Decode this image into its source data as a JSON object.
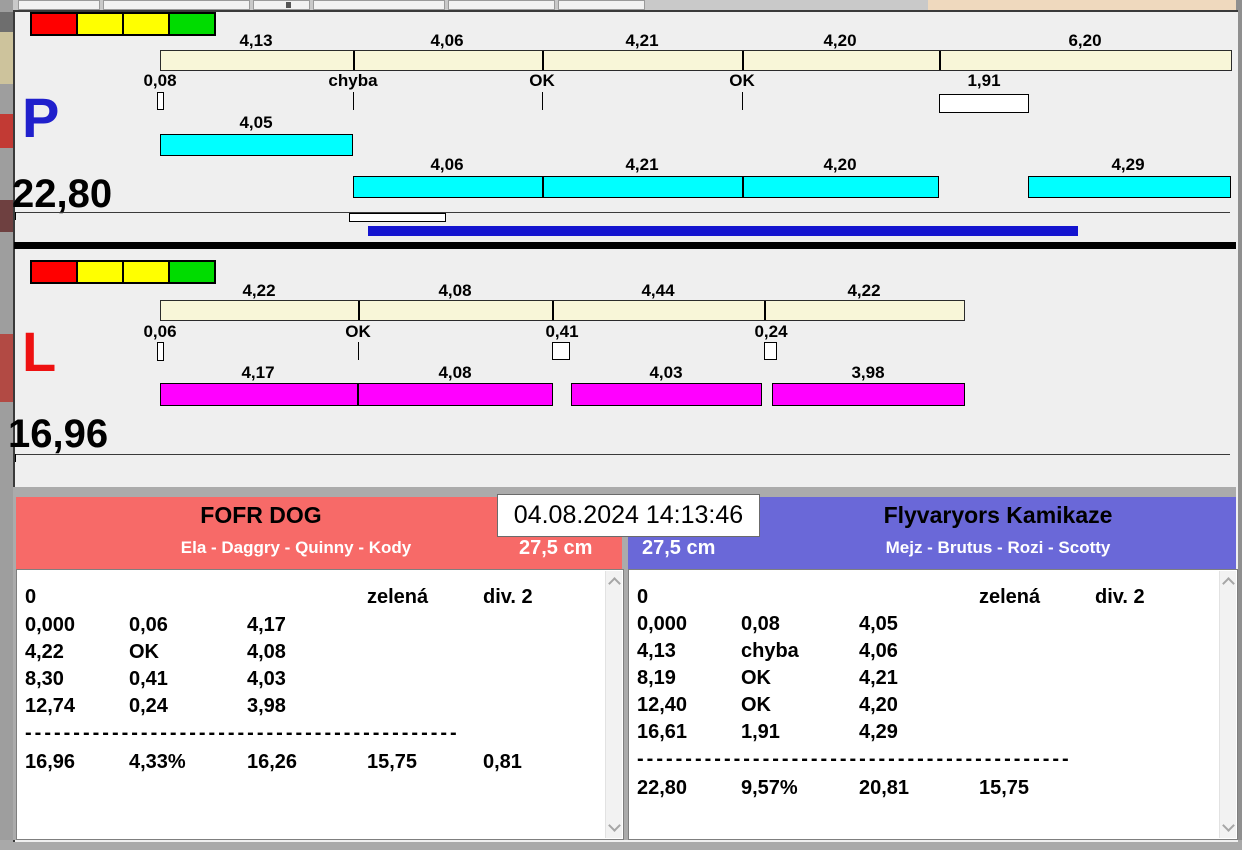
{
  "lanes": {
    "p": {
      "letter": "P",
      "total": "22,80",
      "splits": [
        "4,13",
        "4,06",
        "4,21",
        "4,20",
        "6,20"
      ],
      "crossings": [
        "0,08",
        "chyba",
        "OK",
        "OK",
        "1,91"
      ],
      "dog_times": [
        "4,05",
        "4,06",
        "4,21",
        "4,20",
        "4,29"
      ]
    },
    "l": {
      "letter": "L",
      "total": "16,96",
      "splits": [
        "4,22",
        "4,08",
        "4,44",
        "4,22"
      ],
      "crossings": [
        "0,06",
        "OK",
        "0,41",
        "0,24"
      ],
      "dog_times": [
        "4,17",
        "4,08",
        "4,03",
        "3,98"
      ]
    }
  },
  "scoreboard": {
    "datetime": "04.08.2024 14:13:46",
    "left": {
      "team_name": "FOFR DOG",
      "dog_names": "Ela - Daggry - Quinny - Kody",
      "jump_height": "27,5 cm",
      "table": {
        "header_row": [
          "0",
          "zelená",
          "div. 2"
        ],
        "rows": [
          [
            "0,000",
            "0,06",
            "4,17"
          ],
          [
            "4,22",
            "OK",
            "4,08"
          ],
          [
            "8,30",
            "0,41",
            "4,03"
          ],
          [
            "12,74",
            "0,24",
            "3,98"
          ]
        ],
        "dashes": "---------------------------------------------",
        "total_row": [
          "16,96",
          "4,33%",
          "16,26",
          "15,75",
          "0,81"
        ]
      }
    },
    "right": {
      "team_name": "Flyvaryors Kamikaze",
      "dog_names": "Mejz - Brutus - Rozi - Scotty",
      "jump_height": "27,5 cm",
      "table": {
        "header_row": [
          "0",
          "zelená",
          "div. 2"
        ],
        "rows": [
          [
            "0,000",
            "0,08",
            "4,05"
          ],
          [
            "4,13",
            "chyba",
            "4,06"
          ],
          [
            "8,19",
            "OK",
            "4,21"
          ],
          [
            "12,40",
            "OK",
            "4,20"
          ],
          [
            "16,61",
            "1,91",
            "4,29"
          ]
        ],
        "dashes": "---------------------------------------------",
        "total_row": [
          "22,80",
          "9,57%",
          "20,81",
          "15,75"
        ]
      }
    }
  },
  "colors": {
    "split_bar": "#F8F6D8",
    "lane_p_dog_bar": "#00FFFF",
    "lane_l_dog_bar": "#FF00FF",
    "progress_bar": "#1414CF",
    "team_left_bg": "#F76A68",
    "team_right_bg": "#6A68D8",
    "lane_p_letter": "#2020CC",
    "lane_l_letter": "#EE1111",
    "light_red": "#FF0000",
    "light_yellow": "#FFFF00",
    "light_green": "#00DC00"
  }
}
